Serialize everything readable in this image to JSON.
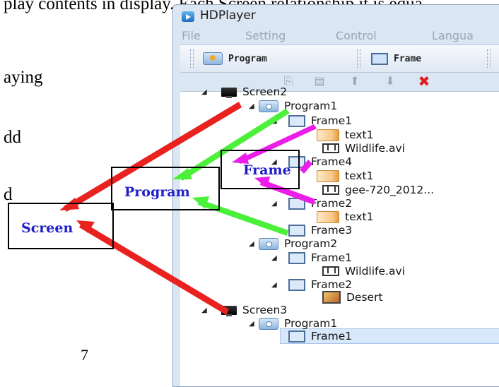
{
  "document": {
    "top_text": "play contents in display. Each Screen relationship it is equa",
    "left_fragments": [
      "aying",
      "dd",
      "d"
    ],
    "page_number": "7"
  },
  "window": {
    "title": "HDPlayer",
    "menu": [
      "File",
      "Setting",
      "Control",
      "Langua"
    ],
    "toolbar": {
      "program_label": "Program",
      "frame_label": "Frame"
    },
    "actions": {
      "copy": "⎘",
      "paste": "▤",
      "up": "⬆",
      "down": "⬇",
      "delete": "✖"
    }
  },
  "tree": [
    {
      "label": "Screen2",
      "type": "screen",
      "level": 0,
      "expanded": true
    },
    {
      "label": "Program1",
      "type": "program",
      "level": 1,
      "expanded": true
    },
    {
      "label": "Frame1",
      "type": "frame",
      "level": 2,
      "expanded": true
    },
    {
      "label": "text1",
      "type": "text",
      "level": 3
    },
    {
      "label": "Wildlife.avi",
      "type": "video",
      "level": 3
    },
    {
      "label": "Frame4",
      "type": "frame",
      "level": 2,
      "expanded": true
    },
    {
      "label": "text1",
      "type": "text",
      "level": 3
    },
    {
      "label": "gee-720_2012...",
      "type": "video",
      "level": 3
    },
    {
      "label": "Frame2",
      "type": "frame",
      "level": 2,
      "expanded": true
    },
    {
      "label": "text1",
      "type": "text",
      "level": 3
    },
    {
      "label": "Frame3",
      "type": "frame",
      "level": 2
    },
    {
      "label": "Program2",
      "type": "program",
      "level": 1,
      "expanded": true
    },
    {
      "label": "Frame1",
      "type": "frame",
      "level": 2,
      "expanded": true
    },
    {
      "label": "Wildlife.avi",
      "type": "video",
      "level": 3
    },
    {
      "label": "Frame2",
      "type": "frame",
      "level": 2,
      "expanded": true
    },
    {
      "label": "Desert",
      "type": "image",
      "level": 3
    },
    {
      "label": "Screen3",
      "type": "screen",
      "level": 0,
      "expanded": true
    },
    {
      "label": "Program1",
      "type": "program",
      "level": 1,
      "expanded": true
    },
    {
      "label": "Frame1",
      "type": "frame",
      "level": 2,
      "selected": true
    }
  ],
  "annotations": {
    "screen_label": "Screen",
    "program_label": "Program",
    "frame_label": "Frame",
    "screen_arrow_color": "#e8221e",
    "program_arrow_color": "#4cf03a",
    "frame_arrow_color": "#ea1ee8"
  },
  "colors": {
    "label_text": "#1f1fc8",
    "window_chrome": "#dbe6f3",
    "selection": "#d8e8fb"
  }
}
